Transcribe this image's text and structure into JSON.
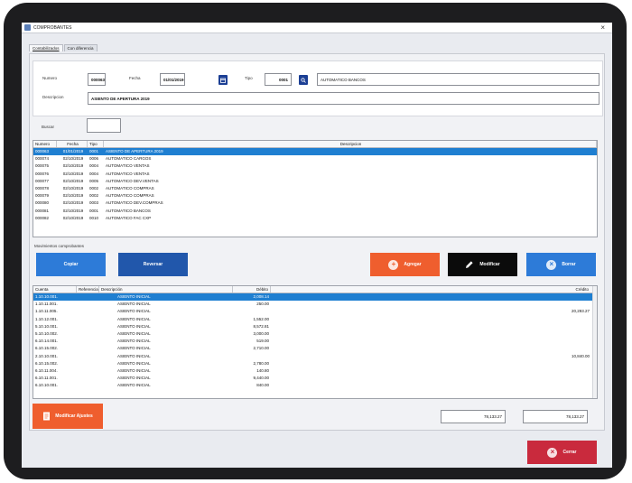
{
  "window": {
    "title": "COMPROBANTES"
  },
  "tabs": [
    {
      "label": "Contabilizados"
    },
    {
      "label": "Con diferencia"
    }
  ],
  "form": {
    "numero_label": "Numero",
    "numero_value": "000063",
    "fecha_label": "Fecha",
    "fecha_value": "01/01/2019",
    "tipo_label": "Tipo",
    "tipo_value": "0001",
    "tipo_desc": "AUTOMATICO BANCOS",
    "descripcion_label": "Descripcion",
    "descripcion_value": "ASIENTO DE APERTURA 2019"
  },
  "search": {
    "label": "Buscar",
    "value": ""
  },
  "vouchers": {
    "headers": [
      "Numero",
      "Fecha",
      "Tipo",
      "Descripcion"
    ],
    "rows": [
      [
        "000063",
        "01/01/2019",
        "0001",
        "ASIENTO DE APERTURA 2019"
      ],
      [
        "000074",
        "02/10/2019",
        "0006",
        "AUTOMATICO CARGOS"
      ],
      [
        "000075",
        "02/10/2019",
        "0004",
        "AUTOMATICO VENTAS"
      ],
      [
        "000076",
        "02/10/2019",
        "0004",
        "AUTOMATICO VENTAS"
      ],
      [
        "000077",
        "02/10/2019",
        "0005",
        "AUTOMATICO DEV.VENTAS"
      ],
      [
        "000078",
        "02/10/2019",
        "0002",
        "AUTOMATICO COMPRAS"
      ],
      [
        "000079",
        "02/10/2019",
        "0002",
        "AUTOMATICO COMPRAS"
      ],
      [
        "000080",
        "02/10/2019",
        "0003",
        "AUTOMATICO DEV.COMPRAS"
      ],
      [
        "000081",
        "02/10/2019",
        "0001",
        "AUTOMATICO BANCOS"
      ],
      [
        "000082",
        "02/10/2019",
        "0010",
        "AUTOMATICO FAC CXP"
      ]
    ]
  },
  "actions": {
    "section_label": "Movimientos comprobantes",
    "copiar": "Copiar",
    "reversar": "Reversar",
    "agregar": "Agregar",
    "modificar": "Modificar",
    "borrar": "Borrar"
  },
  "entries": {
    "headers": [
      "Cuenta",
      "Referencia",
      "Descripción",
      "Débito",
      "Crédito"
    ],
    "rows": [
      [
        "1.10.10.001.",
        "",
        "ASIENTO INICIAL",
        "2,008.14",
        ""
      ],
      [
        "1.10.11.001.",
        "",
        "ASIENTO INICIAL",
        "250.00",
        ""
      ],
      [
        "1.10.11.005.",
        "",
        "ASIENTO INICIAL",
        "",
        "20,293.27"
      ],
      [
        "1.10.12.001.",
        "",
        "ASIENTO INICIAL",
        "1,552.00",
        ""
      ],
      [
        "5.10.10.001.",
        "",
        "ASIENTO INICIAL",
        "8,572.81",
        ""
      ],
      [
        "5.10.10.002.",
        "",
        "ASIENTO INICIAL",
        "3,000.00",
        ""
      ],
      [
        "6.10.14.001.",
        "",
        "ASIENTO INICIAL",
        "519.00",
        ""
      ],
      [
        "6.10.15.002.",
        "",
        "ASIENTO INICIAL",
        "2,710.00",
        ""
      ],
      [
        "2.10.10.001.",
        "",
        "ASIENTO INICIAL",
        "",
        "10,840.00"
      ],
      [
        "6.10.15.002.",
        "",
        "ASIENTO INICIAL",
        "2,780.00",
        ""
      ],
      [
        "6.10.11.004.",
        "",
        "ASIENTO INICIAL",
        "140.80",
        ""
      ],
      [
        "6.10.11.001.",
        "",
        "ASIENTO INICIAL",
        "9,440.00",
        ""
      ],
      [
        "6.10.10.001.",
        "",
        "ASIENTO INICIAL",
        "840.00",
        ""
      ]
    ]
  },
  "totals": {
    "debito": "78,133.27",
    "credito": "78,133.27"
  },
  "footer": {
    "modificar_ajustes": "Modificar Ajustes",
    "cerrar": "Cerrar"
  },
  "colors": {
    "selected_row": "#1f7fd1",
    "agregar": "#ef5e2e",
    "borrar": "#2d7bd8",
    "cerrar": "#c92a3d"
  }
}
